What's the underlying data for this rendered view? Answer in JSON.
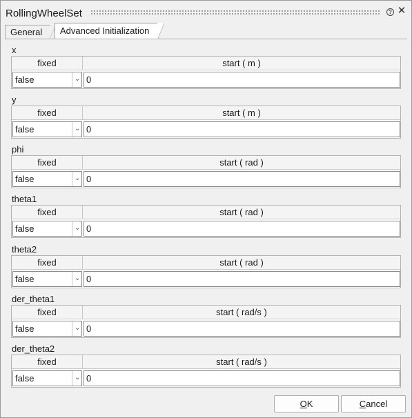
{
  "window": {
    "title": "RollingWheelSet"
  },
  "tabs": [
    {
      "label": "General"
    },
    {
      "label": "Advanced Initialization"
    }
  ],
  "columns": {
    "fixed": "fixed"
  },
  "sections": [
    {
      "name": "x",
      "start_header": "start ( m )",
      "fixed": "false",
      "start": "0"
    },
    {
      "name": "y",
      "start_header": "start ( m )",
      "fixed": "false",
      "start": "0"
    },
    {
      "name": "phi",
      "start_header": "start ( rad )",
      "fixed": "false",
      "start": "0"
    },
    {
      "name": "theta1",
      "start_header": "start ( rad )",
      "fixed": "false",
      "start": "0"
    },
    {
      "name": "theta2",
      "start_header": "start ( rad )",
      "fixed": "false",
      "start": "0"
    },
    {
      "name": "der_theta1",
      "start_header": "start ( rad/s )",
      "fixed": "false",
      "start": "0"
    },
    {
      "name": "der_theta2",
      "start_header": "start ( rad/s )",
      "fixed": "false",
      "start": "0"
    }
  ],
  "buttons": {
    "ok": {
      "mnemonic": "O",
      "rest": "K"
    },
    "cancel": {
      "mnemonic": "C",
      "rest": "ancel"
    }
  },
  "icons": {
    "help": "help-icon",
    "close": "close-icon",
    "dropdown": "chevron-down-icon"
  }
}
